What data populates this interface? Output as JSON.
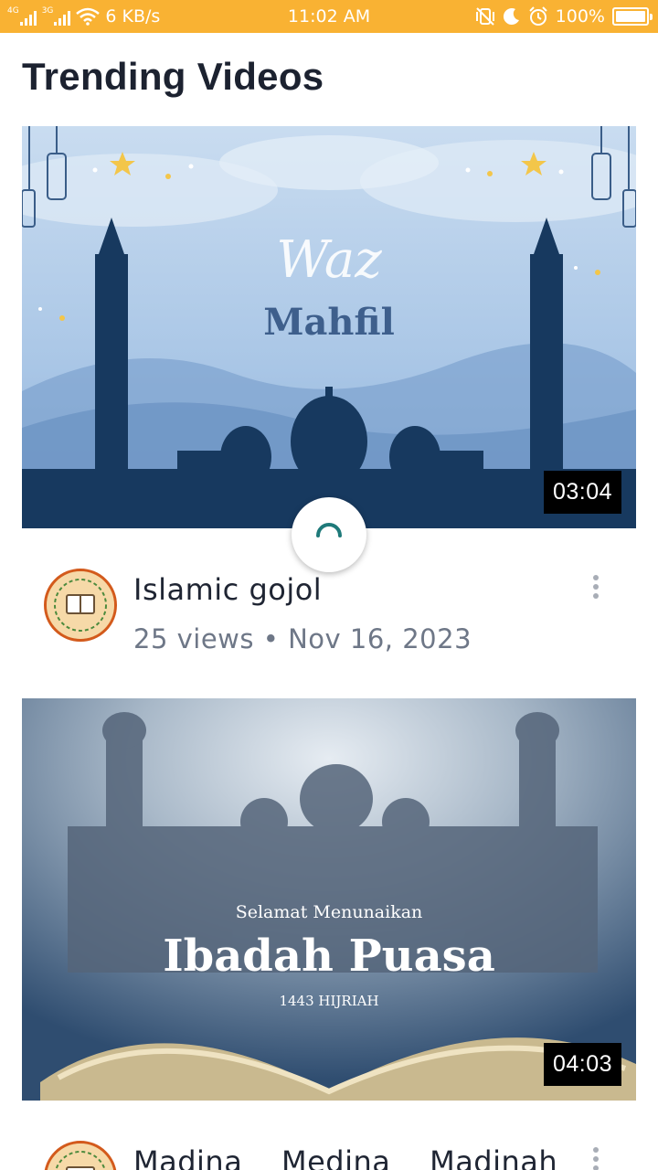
{
  "status_bar": {
    "net_speed": "6 KB/s",
    "time": "11:02 AM",
    "battery": "100%",
    "sim1_type": "4G",
    "sim2_type": "3G",
    "color": "#f9b233"
  },
  "header": {
    "title": "Trending Videos"
  },
  "videos": [
    {
      "duration": "03:04",
      "title": "Islamic gojol",
      "views": "25 views",
      "separator": "•",
      "date": "Nov 16, 2023",
      "thumb_text_script": "Waz",
      "thumb_text_main": "Mahfil"
    },
    {
      "duration": "04:03",
      "title": "Madina    Medina    Madinah",
      "thumb_text_top": "Selamat Menunaikan",
      "thumb_text_main": "Ibadah Puasa",
      "thumb_text_sub": "1443 HIJRIAH"
    }
  ],
  "loading": true,
  "accent_color": "#1f7a7a"
}
